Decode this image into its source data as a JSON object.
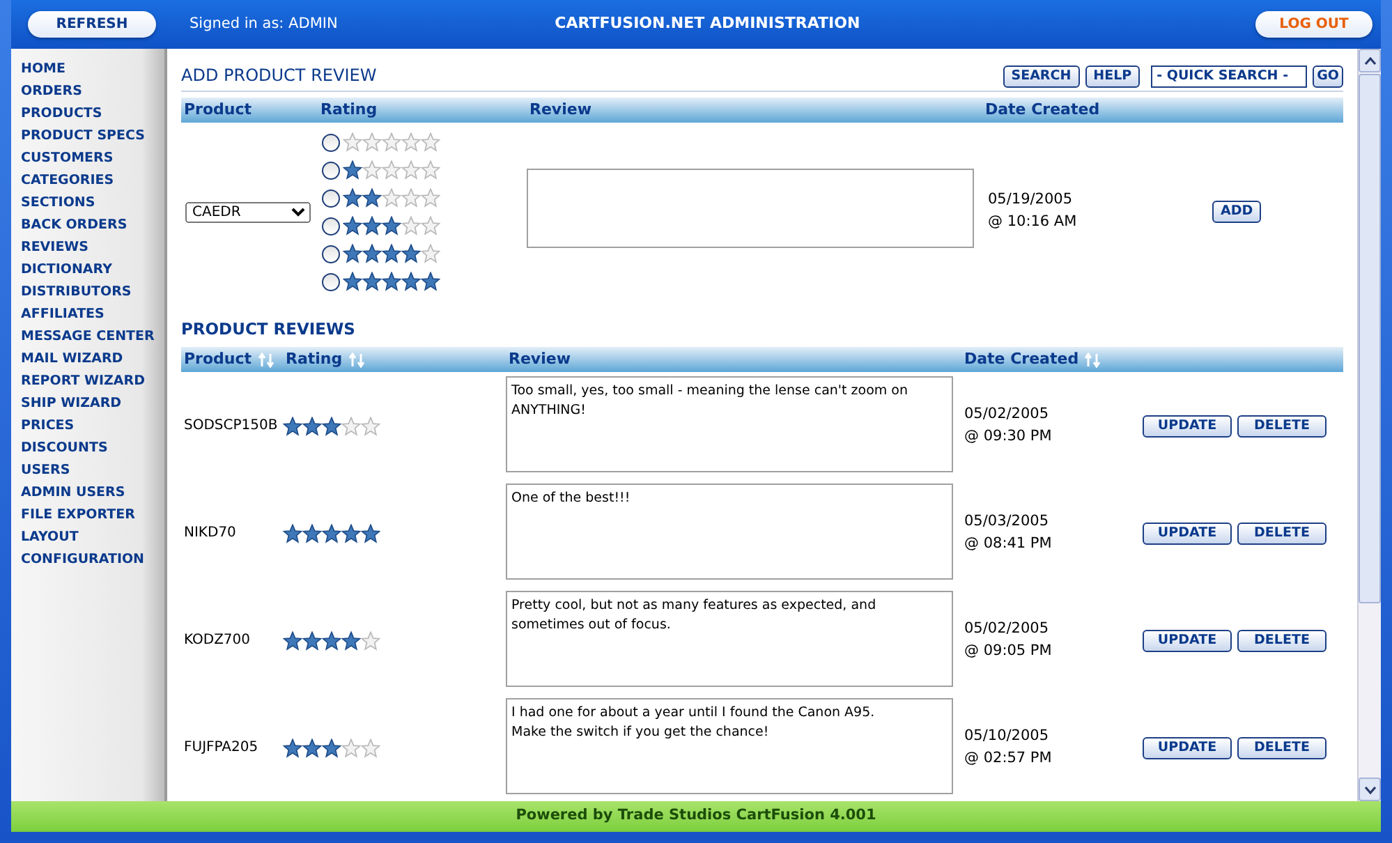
{
  "header": {
    "refresh": "REFRESH",
    "signed_in": "Signed in as: ADMIN",
    "title": "CARTFUSION.NET ADMINISTRATION",
    "logout": "LOG OUT"
  },
  "sidebar": {
    "items": [
      "HOME",
      "ORDERS",
      "PRODUCTS",
      "PRODUCT SPECS",
      "CUSTOMERS",
      "CATEGORIES",
      "SECTIONS",
      "BACK ORDERS",
      "REVIEWS",
      "DICTIONARY",
      "DISTRIBUTORS",
      "AFFILIATES",
      "MESSAGE CENTER",
      "MAIL WIZARD",
      "REPORT WIZARD",
      "SHIP WIZARD",
      "PRICES",
      "DISCOUNTS",
      "USERS",
      "ADMIN USERS",
      "FILE EXPORTER",
      "LAYOUT",
      "CONFIGURATION"
    ]
  },
  "add_review": {
    "title": "ADD PRODUCT REVIEW",
    "buttons": [
      "SEARCH",
      "HELP"
    ],
    "quick_search": "- QUICK SEARCH -",
    "go": "GO",
    "columns": [
      "Product",
      "Rating",
      "Review",
      "Date Created"
    ],
    "product": "CAEDR",
    "rating_options": [
      {
        "stars": 0,
        "selected": false
      },
      {
        "stars": 1,
        "selected": false
      },
      {
        "stars": 2,
        "selected": false
      },
      {
        "stars": 3,
        "selected": false
      },
      {
        "stars": 4,
        "selected": false
      },
      {
        "stars": 5,
        "selected": false
      }
    ],
    "date": "05/19/2005",
    "time": "@ 10:16 AM",
    "add": "ADD"
  },
  "reviews": {
    "title": "PRODUCT REVIEWS",
    "columns": [
      {
        "label": "Product",
        "sortable": true
      },
      {
        "label": "Rating",
        "sortable": true
      },
      {
        "label": "Review",
        "sortable": false
      },
      {
        "label": "Date Created",
        "sortable": true
      }
    ],
    "rows": [
      {
        "product": "SODSCP150B",
        "stars": 3,
        "review": "Too small, yes, too small - meaning the lense can't zoom on ANYTHING!",
        "date": "05/02/2005",
        "time": "@ 09:30 PM",
        "buttons": [
          "UPDATE",
          "DELETE"
        ]
      },
      {
        "product": "NIKD70",
        "stars": 5,
        "review": "One of the best!!!",
        "date": "05/03/2005",
        "time": "@ 08:41 PM",
        "buttons": [
          "UPDATE",
          "DELETE"
        ]
      },
      {
        "product": "KODZ700",
        "stars": 4,
        "review": "Pretty cool, but not as many features as expected, and sometimes out of focus.",
        "date": "05/02/2005",
        "time": "@ 09:05 PM",
        "buttons": [
          "UPDATE",
          "DELETE"
        ]
      },
      {
        "product": "FUJFPA205",
        "stars": 3,
        "review": "I had one for about a year until I found the Canon A95.\nMake the switch if you get the chance!",
        "date": "05/10/2005",
        "time": "@ 02:57 PM",
        "buttons": [
          "UPDATE",
          "DELETE"
        ]
      }
    ]
  },
  "footer": "Powered by Trade Studios CartFusion 4.001"
}
